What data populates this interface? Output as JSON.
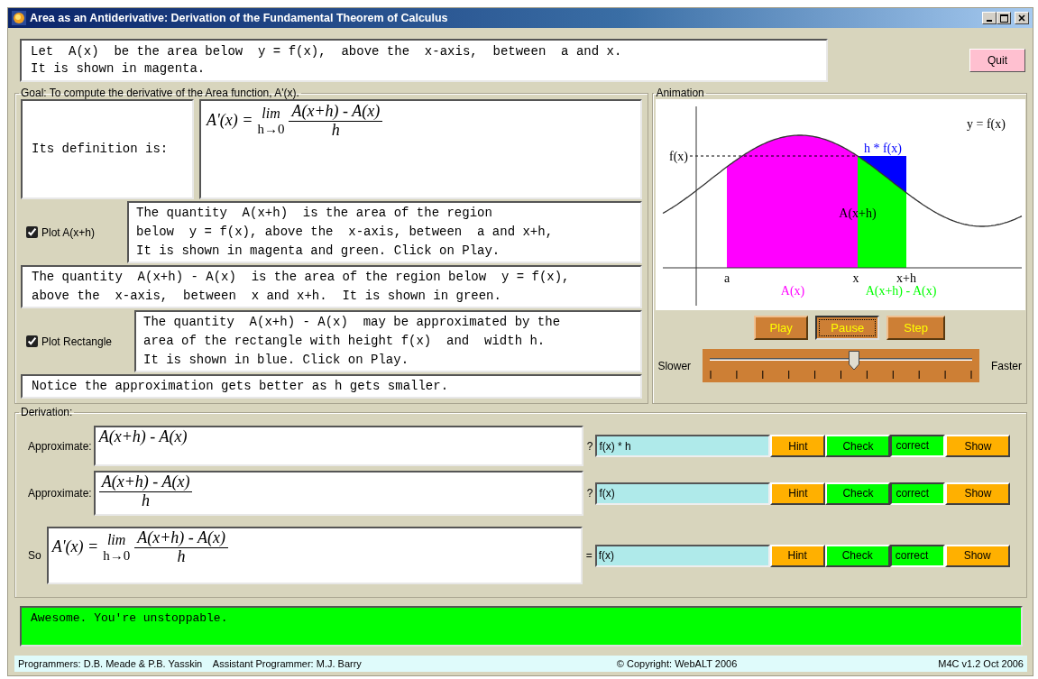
{
  "window": {
    "title": "Area as an Antiderivative: Derivation of the Fundamental Theorem of Calculus"
  },
  "intro": {
    "lines": [
      "Let  A(x)  be the area below  y = f(x),  above the  x-axis,  between  a and x.",
      "It is shown in magenta."
    ]
  },
  "quit_button": "Quit",
  "goal": {
    "legend": "Goal:  To compute the derivative of the Area function,  A'(x).",
    "definition": {
      "label": "Its definition is:",
      "formula": {
        "kind": "limit",
        "lhs": "A'(x) =",
        "lim": "lim",
        "lim_sub": "h→0",
        "numerator": "A(x+h) - A(x)",
        "denominator": "h"
      }
    },
    "sections": [
      {
        "kind": "toggle",
        "checkbox": {
          "label": "Plot A(x+h)",
          "checked": true
        },
        "lines": [
          "The quantity  A(x+h)  is the area of the region",
          "below  y = f(x), above the  x-axis, between  a and x+h,",
          "It is shown in magenta and green. Click on Play."
        ]
      },
      {
        "kind": "text",
        "lines": [
          "The quantity  A(x+h) - A(x)  is the area of the region below  y = f(x),",
          "above the  x-axis,  between  x and x+h.  It is shown in green."
        ]
      },
      {
        "kind": "toggle",
        "checkbox": {
          "label": "Plot Rectangle",
          "checked": true
        },
        "lines": [
          "The quantity  A(x+h) - A(x)  may be approximated by the",
          "area of the rectangle with height f(x)  and  width h.",
          "It is shown in blue. Click on Play."
        ]
      },
      {
        "kind": "text",
        "lines": [
          "Notice the approximation gets better as h gets smaller."
        ]
      }
    ]
  },
  "animation": {
    "legend": "Animation",
    "graph": {
      "curve_label": "y = f(x)",
      "height_label": "f(x)",
      "rectangle_label": "h * f(x)",
      "region_label": "A(x+h)",
      "a_label": "a",
      "x_label": "x",
      "xh_label": "x+h",
      "area_legend": "A(x)",
      "strip_legend": "A(x+h) - A(x)"
    },
    "buttons": [
      {
        "label": "Play",
        "pressed": false
      },
      {
        "label": "Pause",
        "pressed": true
      },
      {
        "label": "Step",
        "pressed": false
      }
    ],
    "speed": {
      "slower": "Slower",
      "faster": "Faster",
      "level": 0.55
    }
  },
  "derivation": {
    "legend": "Derivation:",
    "rows": [
      {
        "label": "Approximate:",
        "formula": {
          "kind": "difference",
          "numerator": "A(x+h) - A(x)"
        },
        "relation": "?",
        "answer": "f(x) * h",
        "hint": "Hint",
        "check": "Check",
        "status": "correct",
        "show": "Show"
      },
      {
        "label": "Approximate:",
        "formula": {
          "kind": "quotient",
          "numerator": "A(x+h) - A(x)",
          "denominator": "h"
        },
        "relation": "?",
        "answer": "f(x)",
        "hint": "Hint",
        "check": "Check",
        "status": "correct",
        "show": "Show"
      },
      {
        "label": "So",
        "formula": {
          "kind": "limit",
          "lhs": "A'(x) =",
          "lim": "lim",
          "lim_sub": "h→0",
          "numerator": "A(x+h) - A(x)",
          "denominator": "h"
        },
        "relation": "=",
        "answer": "f(x)",
        "hint": "Hint",
        "check": "Check",
        "status": "correct",
        "show": "Show"
      }
    ]
  },
  "message": "Awesome. You're unstoppable.",
  "footer": {
    "programmers": "Programmers: D.B. Meade & P.B. Yasskin    Assistant Programmer: M.J. Barry",
    "copyright": "© Copyright: WebALT 2006",
    "version": "M4C v1.2 Oct 2006"
  }
}
